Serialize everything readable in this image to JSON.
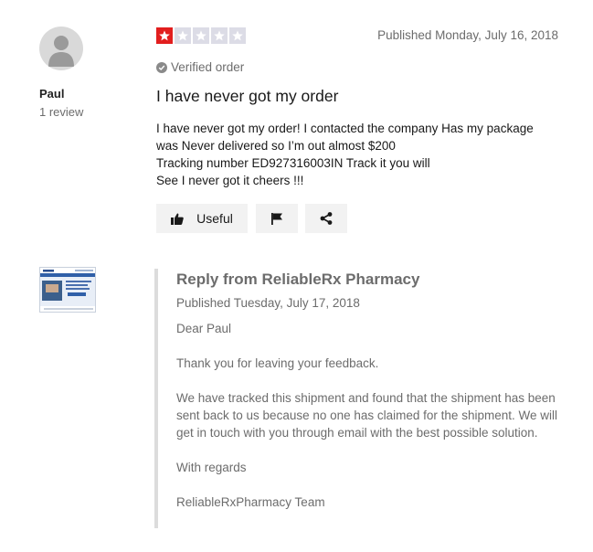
{
  "reviewer": {
    "name": "Paul",
    "review_count": "1 review"
  },
  "review": {
    "rating": 1,
    "max_rating": 5,
    "published": "Published Monday, July 16, 2018",
    "verified": "Verified order",
    "title": "I have never got my order",
    "body_lines": [
      "I have never got my order! I contacted the company Has my package",
      "was Never delivered so I’m out almost $200",
      "Tracking number ED927316003IN Track it you will",
      "See I never got it cheers !!!"
    ]
  },
  "actions": {
    "useful_label": "Useful",
    "useful_icon": "thumbs-up-icon",
    "flag_icon": "flag-icon",
    "share_icon": "share-icon"
  },
  "reply": {
    "title": "Reply from ReliableRx Pharmacy",
    "published": "Published Tuesday, July 17, 2018",
    "paragraphs": [
      "Dear Paul",
      "Thank you for leaving your feedback.",
      "We have tracked this shipment and found that the shipment has been sent back to us because no one has claimed for the shipment. We will get in touch with you through email with the best possible solution.",
      "With regards",
      "ReliableRxPharmacy Team"
    ]
  },
  "colors": {
    "star_filled": "#e21e1e",
    "star_empty": "#dcdce6",
    "muted_text": "#6c6c6c",
    "button_bg": "#f2f2f2",
    "reply_bar": "#dcdcdc"
  }
}
